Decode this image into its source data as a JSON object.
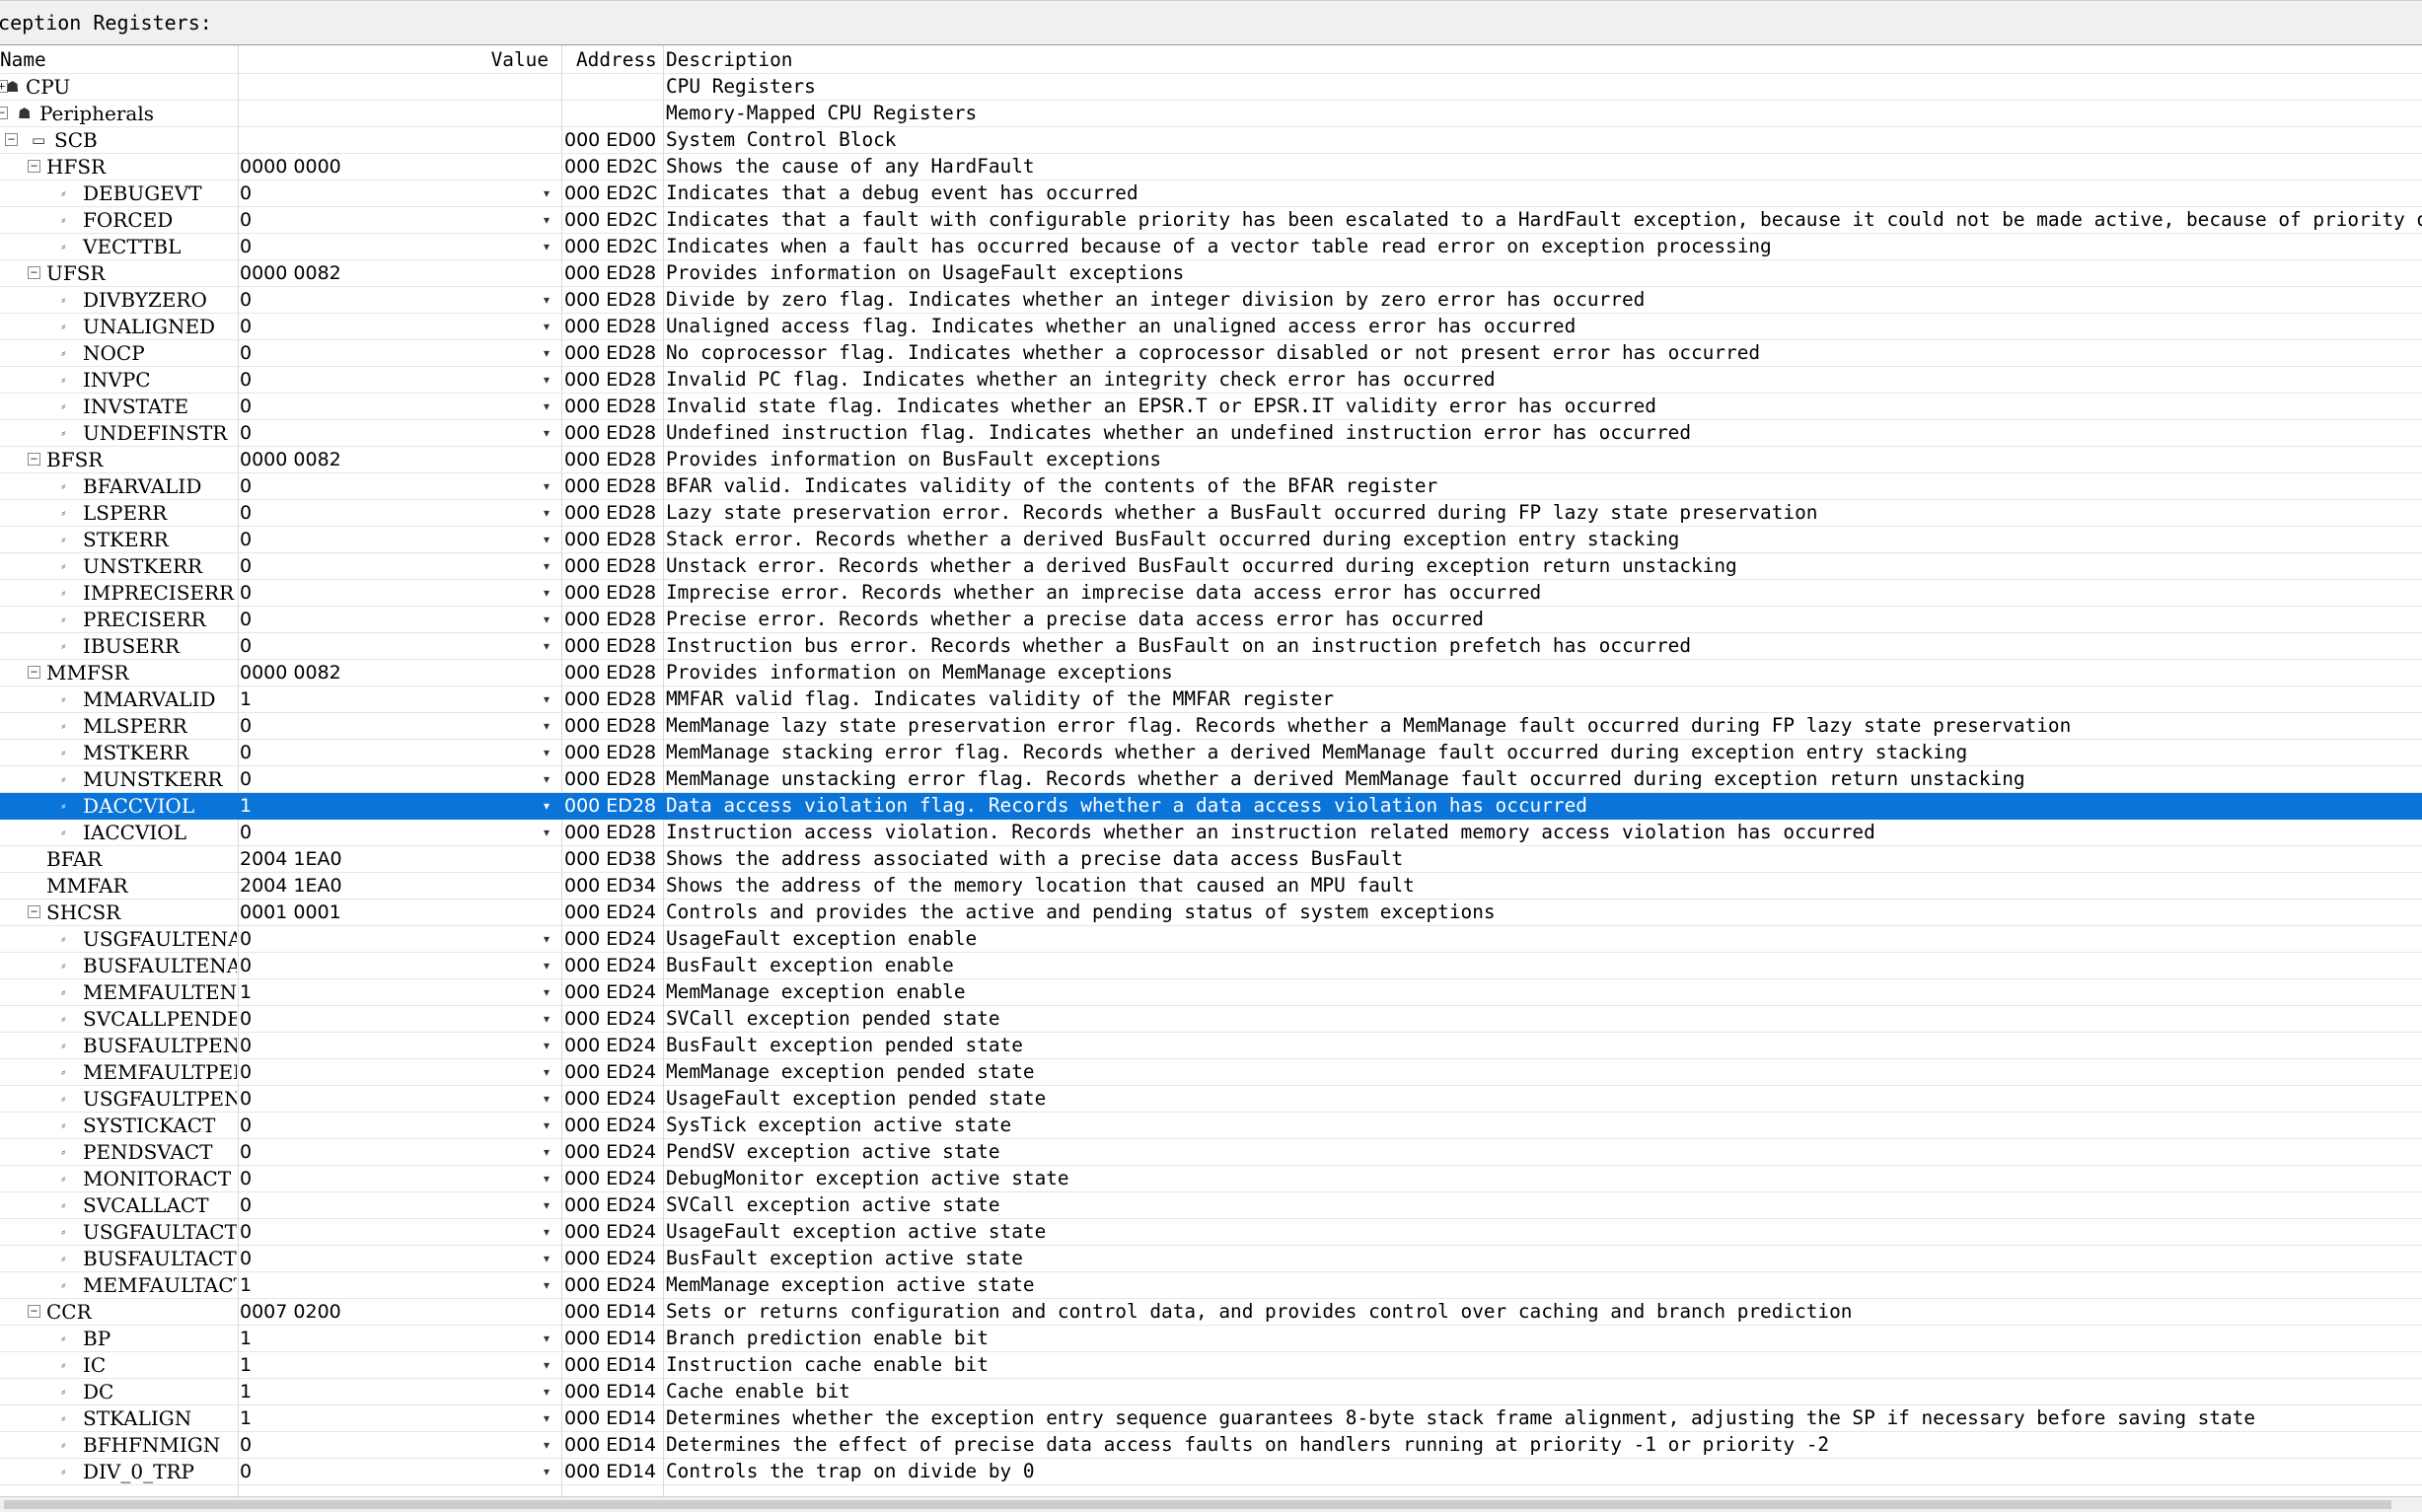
{
  "window": {
    "title": "xception Registers:"
  },
  "columns": {
    "name": "Name",
    "value": "Value",
    "address": "Address",
    "description": "Description"
  },
  "rows": [
    {
      "level": 0,
      "node": "group",
      "toggle": "plus",
      "name": "CPU",
      "value": "",
      "address": "",
      "desc": "CPU Registers"
    },
    {
      "level": 0,
      "node": "group",
      "toggle": "minus",
      "name": "Peripherals",
      "value": "",
      "address": "",
      "desc": "Memory-Mapped CPU Registers"
    },
    {
      "level": 1,
      "node": "block",
      "toggle": "minus",
      "name": "SCB",
      "value": "",
      "address": "000 ED00",
      "desc": "System Control Block"
    },
    {
      "level": 2,
      "node": "reg",
      "toggle": "minus",
      "name": "HFSR",
      "value": "0000 0000",
      "address": "000 ED2C",
      "desc": "Shows the cause of any HardFault"
    },
    {
      "level": 3,
      "node": "field",
      "name": "DEBUGEVT",
      "value": "0",
      "address": "000 ED2C",
      "desc": "Indicates that a debug event has occurred"
    },
    {
      "level": 3,
      "node": "field",
      "name": "FORCED",
      "value": "0",
      "address": "000 ED2C",
      "desc": "Indicates that a fault with configurable priority has been escalated to a HardFault exception, because it could not be made active, because of priority or because"
    },
    {
      "level": 3,
      "node": "field",
      "name": "VECTTBL",
      "value": "0",
      "address": "000 ED2C",
      "desc": "Indicates when a fault has occurred because of a vector table read error on exception processing"
    },
    {
      "level": 2,
      "node": "reg",
      "toggle": "minus",
      "name": "UFSR",
      "value": "0000 0082",
      "address": "000 ED28",
      "desc": "Provides information on UsageFault exceptions"
    },
    {
      "level": 3,
      "node": "field",
      "name": "DIVBYZERO",
      "value": "0",
      "address": "000 ED28",
      "desc": "Divide by zero flag. Indicates whether an integer division by zero error has occurred"
    },
    {
      "level": 3,
      "node": "field",
      "name": "UNALIGNED",
      "value": "0",
      "address": "000 ED28",
      "desc": "Unaligned access flag. Indicates whether an unaligned access error has occurred"
    },
    {
      "level": 3,
      "node": "field",
      "name": "NOCP",
      "value": "0",
      "address": "000 ED28",
      "desc": "No coprocessor flag. Indicates whether a coprocessor disabled or not present error has occurred"
    },
    {
      "level": 3,
      "node": "field",
      "name": "INVPC",
      "value": "0",
      "address": "000 ED28",
      "desc": "Invalid PC flag. Indicates whether an integrity check error has occurred"
    },
    {
      "level": 3,
      "node": "field",
      "name": "INVSTATE",
      "value": "0",
      "address": "000 ED28",
      "desc": "Invalid state flag. Indicates whether an EPSR.T or EPSR.IT validity error has occurred"
    },
    {
      "level": 3,
      "node": "field",
      "name": "UNDEFINSTR",
      "value": "0",
      "address": "000 ED28",
      "desc": "Undefined instruction flag. Indicates whether an undefined instruction error has occurred"
    },
    {
      "level": 2,
      "node": "reg",
      "toggle": "minus",
      "name": "BFSR",
      "value": "0000 0082",
      "address": "000 ED28",
      "desc": "Provides information on BusFault exceptions"
    },
    {
      "level": 3,
      "node": "field",
      "name": "BFARVALID",
      "value": "0",
      "address": "000 ED28",
      "desc": "BFAR valid. Indicates validity of the contents of the BFAR register"
    },
    {
      "level": 3,
      "node": "field",
      "name": "LSPERR",
      "value": "0",
      "address": "000 ED28",
      "desc": "Lazy state preservation error. Records whether a BusFault occurred during FP lazy state preservation"
    },
    {
      "level": 3,
      "node": "field",
      "name": "STKERR",
      "value": "0",
      "address": "000 ED28",
      "desc": "Stack error. Records whether a derived BusFault occurred during exception entry stacking"
    },
    {
      "level": 3,
      "node": "field",
      "name": "UNSTKERR",
      "value": "0",
      "address": "000 ED28",
      "desc": "Unstack error. Records whether a derived BusFault occurred during exception return unstacking"
    },
    {
      "level": 3,
      "node": "field",
      "name": "IMPRECISERR",
      "value": "0",
      "address": "000 ED28",
      "desc": "Imprecise error. Records whether an imprecise data access error has occurred"
    },
    {
      "level": 3,
      "node": "field",
      "name": "PRECISERR",
      "value": "0",
      "address": "000 ED28",
      "desc": "Precise error. Records whether a precise data access error has occurred"
    },
    {
      "level": 3,
      "node": "field",
      "name": "IBUSERR",
      "value": "0",
      "address": "000 ED28",
      "desc": "Instruction bus error. Records whether a BusFault on an instruction prefetch has occurred"
    },
    {
      "level": 2,
      "node": "reg",
      "toggle": "minus",
      "name": "MMFSR",
      "value": "0000 0082",
      "address": "000 ED28",
      "desc": "Provides information on MemManage exceptions"
    },
    {
      "level": 3,
      "node": "field",
      "name": "MMARVALID",
      "value": "1",
      "address": "000 ED28",
      "desc": "MMFAR valid flag. Indicates validity of the MMFAR register"
    },
    {
      "level": 3,
      "node": "field",
      "name": "MLSPERR",
      "value": "0",
      "address": "000 ED28",
      "desc": "MemManage lazy state preservation error flag. Records whether a MemManage fault occurred during FP lazy state preservation"
    },
    {
      "level": 3,
      "node": "field",
      "name": "MSTKERR",
      "value": "0",
      "address": "000 ED28",
      "desc": "MemManage stacking error flag. Records whether a derived MemManage fault occurred during exception entry stacking"
    },
    {
      "level": 3,
      "node": "field",
      "name": "MUNSTKERR",
      "value": "0",
      "address": "000 ED28",
      "desc": "MemManage unstacking error flag. Records whether a derived MemManage fault occurred during exception return unstacking"
    },
    {
      "level": 3,
      "node": "field",
      "name": "DACCVIOL",
      "value": "1",
      "address": "000 ED28",
      "desc": "Data access violation flag. Records whether a data access violation has occurred",
      "selected": true
    },
    {
      "level": 3,
      "node": "field",
      "name": "IACCVIOL",
      "value": "0",
      "address": "000 ED28",
      "desc": "Instruction access violation. Records whether an instruction related memory access violation has occurred"
    },
    {
      "level": 2,
      "node": "plain",
      "name": "BFAR",
      "value": "2004 1EA0",
      "address": "000 ED38",
      "desc": "Shows the address associated with a precise data access BusFault"
    },
    {
      "level": 2,
      "node": "plain",
      "name": "MMFAR",
      "value": "2004 1EA0",
      "address": "000 ED34",
      "desc": "Shows the address of the memory location that caused an MPU fault"
    },
    {
      "level": 2,
      "node": "reg",
      "toggle": "minus",
      "name": "SHCSR",
      "value": "0001 0001",
      "address": "000 ED24",
      "desc": "Controls and provides the active and pending status of system exceptions"
    },
    {
      "level": 3,
      "node": "field",
      "name": "USGFAULTENA",
      "value": "0",
      "address": "000 ED24",
      "desc": "UsageFault exception enable"
    },
    {
      "level": 3,
      "node": "field",
      "name": "BUSFAULTENA",
      "value": "0",
      "address": "000 ED24",
      "desc": "BusFault exception enable"
    },
    {
      "level": 3,
      "node": "field",
      "name": "MEMFAULTENA",
      "value": "1",
      "address": "000 ED24",
      "desc": "MemManage exception enable"
    },
    {
      "level": 3,
      "node": "field",
      "name": "SVCALLPENDED",
      "value": "0",
      "address": "000 ED24",
      "desc": "SVCall exception pended state"
    },
    {
      "level": 3,
      "node": "field",
      "name": "BUSFAULTPENDED",
      "value": "0",
      "address": "000 ED24",
      "desc": "BusFault exception pended state"
    },
    {
      "level": 3,
      "node": "field",
      "name": "MEMFAULTPENDED",
      "value": "0",
      "address": "000 ED24",
      "desc": "MemManage exception pended state"
    },
    {
      "level": 3,
      "node": "field",
      "name": "USGFAULTPENDED",
      "value": "0",
      "address": "000 ED24",
      "desc": "UsageFault exception pended state"
    },
    {
      "level": 3,
      "node": "field",
      "name": "SYSTICKACT",
      "value": "0",
      "address": "000 ED24",
      "desc": "SysTick exception active state"
    },
    {
      "level": 3,
      "node": "field",
      "name": "PENDSVACT",
      "value": "0",
      "address": "000 ED24",
      "desc": "PendSV exception active state"
    },
    {
      "level": 3,
      "node": "field",
      "name": "MONITORACT",
      "value": "0",
      "address": "000 ED24",
      "desc": "DebugMonitor exception active state"
    },
    {
      "level": 3,
      "node": "field",
      "name": "SVCALLACT",
      "value": "0",
      "address": "000 ED24",
      "desc": "SVCall exception active state"
    },
    {
      "level": 3,
      "node": "field",
      "name": "USGFAULTACT",
      "value": "0",
      "address": "000 ED24",
      "desc": "UsageFault exception active state"
    },
    {
      "level": 3,
      "node": "field",
      "name": "BUSFAULTACT",
      "value": "0",
      "address": "000 ED24",
      "desc": "BusFault exception active state"
    },
    {
      "level": 3,
      "node": "field",
      "name": "MEMFAULTACT",
      "value": "1",
      "address": "000 ED24",
      "desc": "MemManage exception active state"
    },
    {
      "level": 2,
      "node": "reg",
      "toggle": "minus",
      "name": "CCR",
      "value": "0007 0200",
      "address": "000 ED14",
      "desc": "Sets or returns configuration and control data, and provides control over caching and branch prediction"
    },
    {
      "level": 3,
      "node": "field",
      "name": "BP",
      "value": "1",
      "address": "000 ED14",
      "desc": "Branch prediction enable bit"
    },
    {
      "level": 3,
      "node": "field",
      "name": "IC",
      "value": "1",
      "address": "000 ED14",
      "desc": "Instruction cache enable bit"
    },
    {
      "level": 3,
      "node": "field",
      "name": "DC",
      "value": "1",
      "address": "000 ED14",
      "desc": "Cache enable bit"
    },
    {
      "level": 3,
      "node": "field",
      "name": "STKALIGN",
      "value": "1",
      "address": "000 ED14",
      "desc": "Determines whether the exception entry sequence guarantees 8-byte stack frame alignment, adjusting the SP if necessary before saving state"
    },
    {
      "level": 3,
      "node": "field",
      "name": "BFHFNMIGN",
      "value": "0",
      "address": "000 ED14",
      "desc": "Determines the effect of precise data access faults on handlers running at priority -1 or priority -2"
    },
    {
      "level": 3,
      "node": "field",
      "name": "DIV_0_TRP",
      "value": "0",
      "address": "000 ED14",
      "desc": "Controls the trap on divide by 0"
    }
  ]
}
